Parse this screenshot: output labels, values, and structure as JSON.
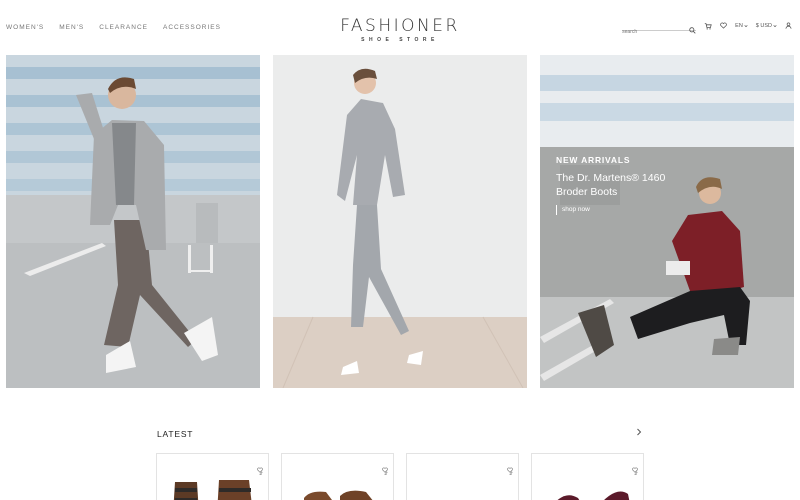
{
  "nav": [
    {
      "label": "WOMEN'S"
    },
    {
      "label": "MEN'S"
    },
    {
      "label": "CLEARANCE"
    },
    {
      "label": "ACCESSORIES"
    }
  ],
  "brand": {
    "name": "FASHIONER",
    "tagline": "SHOE STORE"
  },
  "search": {
    "placeholder": "search"
  },
  "tools": {
    "language": "EN",
    "currency": "$ USD"
  },
  "promo": {
    "kicker": "NEW ARRIVALS",
    "title": "The Dr. Martens® 1460 Broder Boots",
    "link": "shop now"
  },
  "latest": {
    "title": "LATEST",
    "next_icon": "chevron-right-icon"
  },
  "colors": {
    "text": "#222222",
    "muted": "#777777",
    "border": "#e3e3e3"
  },
  "icons": [
    "search-icon",
    "cart-icon",
    "heart-icon",
    "user-icon",
    "chevron-down-icon",
    "compare-icon"
  ]
}
